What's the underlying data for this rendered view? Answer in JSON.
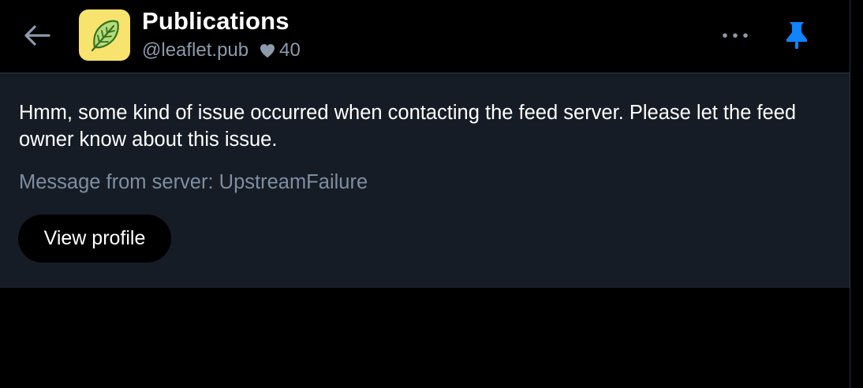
{
  "header": {
    "title": "Publications",
    "handle": "@leaflet.pub",
    "likes": "40",
    "back_icon": "arrow-left-icon",
    "more_icon": "ellipsis-icon",
    "pin_icon": "pin-icon",
    "avatar_icon": "leaf-icon"
  },
  "error": {
    "message": "Hmm, some kind of issue occurred when contacting the feed server. Please let the feed owner know about this issue.",
    "server_message": "Message from server: UpstreamFailure",
    "view_profile_label": "View profile"
  },
  "colors": {
    "background": "#000000",
    "panel": "#161c25",
    "accent": "#1083fe",
    "muted_text": "#8c9aab",
    "avatar_bg": "#f7e36e"
  }
}
